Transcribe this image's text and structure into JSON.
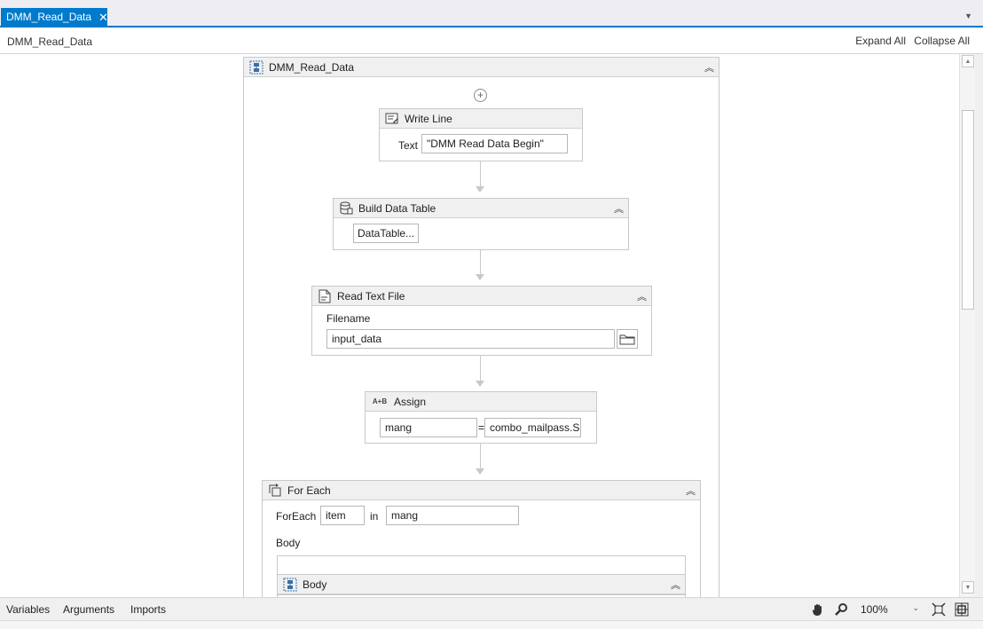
{
  "tab": {
    "title": "DMM_Read_Data",
    "close_glyph": "✕"
  },
  "breadcrumb": {
    "label": "DMM_Read_Data"
  },
  "toolbar": {
    "expand_all": "Expand All",
    "collapse_all": "Collapse All"
  },
  "sequence": {
    "title": "DMM_Read_Data",
    "icon": "sequence-icon"
  },
  "write_line": {
    "title": "Write Line",
    "text_label": "Text",
    "text_value": "\"DMM Read Data Begin\"",
    "icon": "write-line-icon"
  },
  "build_data_table": {
    "title": "Build Data Table",
    "button_label": "DataTable...",
    "icon": "data-table-icon"
  },
  "read_text_file": {
    "title": "Read Text File",
    "filename_label": "Filename",
    "filename_value": "input_data",
    "icon": "file-icon"
  },
  "assign": {
    "title": "Assign",
    "icon_text": "A+B",
    "to_value": "mang",
    "equals": "=",
    "value": "combo_mailpass.S|"
  },
  "for_each": {
    "title": "For Each",
    "foreach_label": "ForEach",
    "item_value": "item",
    "in_label": "in",
    "collection_value": "mang",
    "body_label": "Body",
    "icon": "for-each-icon"
  },
  "body_sequence": {
    "title": "Body",
    "icon": "sequence-icon"
  },
  "bottom": {
    "variables": "Variables",
    "arguments": "Arguments",
    "imports": "Imports",
    "zoom": "100%"
  },
  "colors": {
    "accent": "#007acc",
    "header_bg": "#f0f0f0",
    "border": "#c9c9c9"
  }
}
